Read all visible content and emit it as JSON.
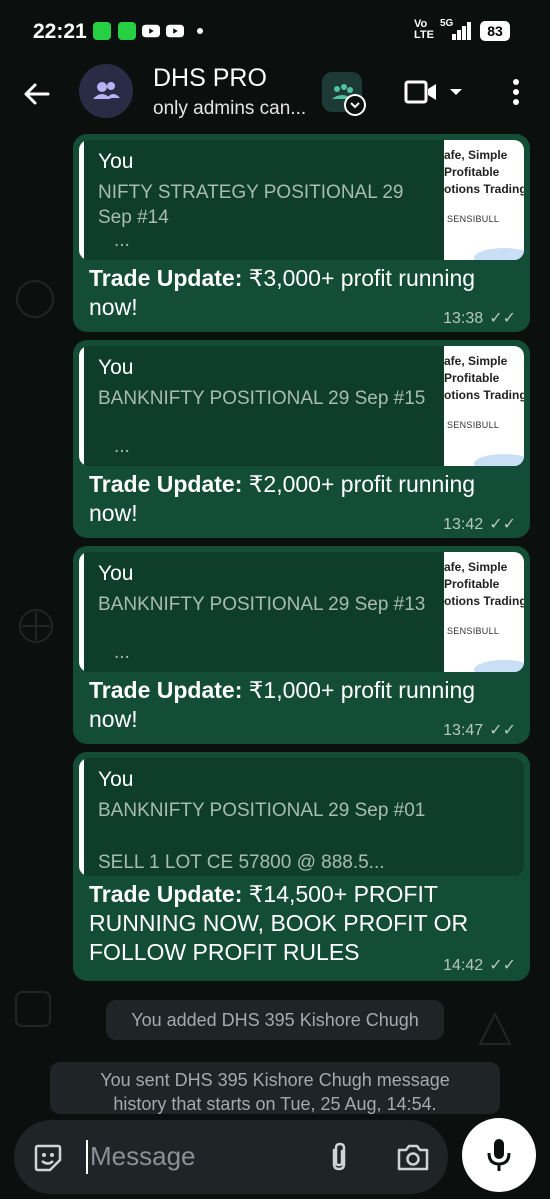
{
  "status_bar": {
    "time": "22:21",
    "network_label": "Vo\nLTE",
    "network_type": "5G",
    "battery": "83"
  },
  "header": {
    "title": "DHS PRO",
    "subtitle": "only admins can...",
    "icons": [
      "back-arrow-icon",
      "group-avatar-icon",
      "community-icon",
      "video-call-icon",
      "chevron-down-icon",
      "more-options-icon"
    ]
  },
  "messages": [
    {
      "quote_author": "You",
      "quote_text": "NIFTY STRATEGY POSITIONAL  29 Sep #14",
      "quote_more": "...",
      "thumb_lines": [
        "afe, Simple",
        "Profitable",
        "otions Trading"
      ],
      "thumb_brand": "SENSIBULL",
      "bold": "Trade Update:",
      "text": " ₹3,000+ profit running now!",
      "time": "13:38",
      "ticks": "✓✓"
    },
    {
      "quote_author": "You",
      "quote_text": "BANKNIFTY  POSITIONAL  29 Sep #15",
      "quote_more": "...",
      "thumb_lines": [
        "afe, Simple",
        "Profitable",
        "otions Trading"
      ],
      "thumb_brand": "SENSIBULL",
      "bold": "Trade Update:",
      "text": " ₹2,000+ profit running now!",
      "time": "13:42",
      "ticks": "✓✓"
    },
    {
      "quote_author": "You",
      "quote_text": "BANKNIFTY  POSITIONAL  29 Sep #13",
      "quote_more": "...",
      "thumb_lines": [
        "afe, Simple",
        "Profitable",
        "otions Trading"
      ],
      "thumb_brand": "SENSIBULL",
      "bold": "Trade Update:",
      "text": " ₹1,000+ profit running now!",
      "time": "13:47",
      "ticks": "✓✓"
    },
    {
      "quote_author": "You",
      "quote_text": "BANKNIFTY  POSITIONAL  29 Sep #01",
      "quote_text2": "SELL 1 LOT CE 57800 @ 888.5...",
      "bold": "Trade Update:",
      "text": " ₹14,500+ PROFIT RUNNING NOW, BOOK PROFIT OR FOLLOW PROFIT RULES",
      "time": "14:42",
      "ticks": "✓✓"
    }
  ],
  "system_messages": [
    "You added DHS 395 Kishore Chugh",
    "You sent DHS 395 Kishore Chugh message history that starts on Tue, 25 Aug, 14:54."
  ],
  "composer": {
    "placeholder": "Message"
  },
  "colors": {
    "bubble": "#144d37",
    "quote_bg": "#0f3d2b",
    "background": "#0b0f0e"
  }
}
